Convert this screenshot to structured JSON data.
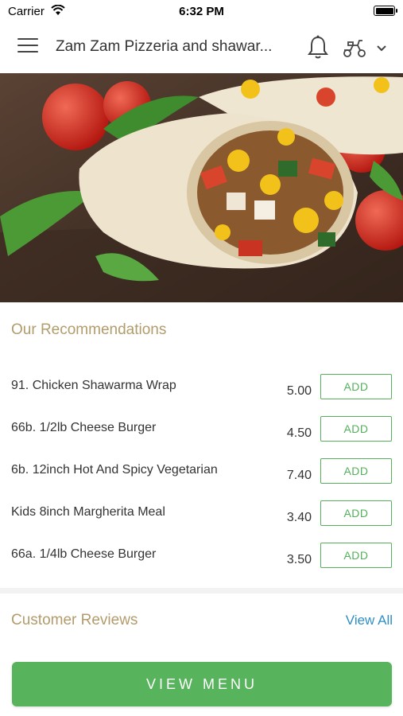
{
  "status_bar": {
    "carrier": "Carrier",
    "time": "6:32 PM"
  },
  "header": {
    "title": "Zam Zam Pizzeria and shawar...",
    "icons": [
      "hamburger-menu-icon",
      "bell-icon",
      "scooter-delivery-icon",
      "chevron-down-icon"
    ]
  },
  "hero": {
    "image": "shawarma-wrap-photo"
  },
  "recommendations": {
    "title": "Our Recommendations",
    "add_label": "ADD",
    "items": [
      {
        "name": "91. Chicken Shawarma Wrap",
        "price": "5.00"
      },
      {
        "name": "66b. 1/2lb Cheese Burger",
        "price": "4.50"
      },
      {
        "name": "6b. 12inch Hot And Spicy Vegetarian",
        "price": "7.40"
      },
      {
        "name": "Kids 8inch Margherita Meal",
        "price": "3.40"
      },
      {
        "name": "66a. 1/4lb Cheese Burger",
        "price": "3.50"
      }
    ]
  },
  "reviews": {
    "title": "Customer Reviews",
    "view_all": "View All"
  },
  "footer": {
    "view_menu": "VIEW MENU"
  },
  "colors": {
    "accent_green": "#57b45d",
    "section_title": "#b29c6c",
    "link_blue": "#2f8fc5"
  }
}
